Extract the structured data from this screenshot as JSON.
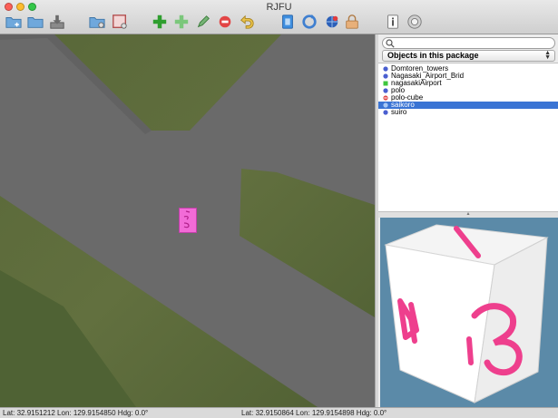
{
  "window": {
    "title": "RJFU"
  },
  "toolbar": {
    "buttons": [
      {
        "name": "new-project-button",
        "icon": "folder-plus-icon"
      },
      {
        "name": "open-folder-button",
        "icon": "folder-icon"
      },
      {
        "name": "save-button",
        "icon": "download-tray-icon"
      },
      {
        "name": "open-package-button",
        "icon": "folder-gear-icon"
      },
      {
        "name": "package-settings-button",
        "icon": "frame-gear-icon"
      },
      {
        "name": "add-object-button",
        "icon": "plus-green-icon"
      },
      {
        "name": "add-light-button",
        "icon": "plus-light-green-icon"
      },
      {
        "name": "edit-object-button",
        "icon": "pencil-icon"
      },
      {
        "name": "delete-object-button",
        "icon": "no-entry-icon"
      },
      {
        "name": "undo-button",
        "icon": "undo-arrow-icon"
      },
      {
        "name": "copy-button",
        "icon": "copy-doc-icon"
      },
      {
        "name": "refresh-button",
        "icon": "refresh-icon"
      },
      {
        "name": "globe-button",
        "icon": "globe-icon"
      },
      {
        "name": "lock-button",
        "icon": "lock-icon"
      },
      {
        "name": "info-button",
        "icon": "info-icon"
      },
      {
        "name": "settings-button",
        "icon": "gear-icon"
      }
    ]
  },
  "panel": {
    "search": {
      "placeholder": "",
      "value": ""
    },
    "dropdown": {
      "selected": "Objects in this package"
    },
    "objects": [
      {
        "label": "Domtoren_towers",
        "icon": "blue-diamond-icon",
        "selected": false
      },
      {
        "label": "Nagasaki_Airport_Brid",
        "icon": "blue-diamond-icon",
        "selected": false
      },
      {
        "label": "nagasakiAirport",
        "icon": "green-square-icon",
        "selected": false
      },
      {
        "label": "polo",
        "icon": "blue-diamond-icon",
        "selected": false
      },
      {
        "label": "polo-cube",
        "icon": "red-no-entry-icon",
        "selected": false
      },
      {
        "label": "saikoro",
        "icon": "light-blue-circle-icon",
        "selected": true
      },
      {
        "label": "suiro",
        "icon": "blue-diamond-icon",
        "selected": false
      }
    ]
  },
  "status": {
    "left": "Lat: 32.9151212  Lon: 129.9154850  Hdg: 0.0°",
    "right": "Lat: 32.9150864  Lon: 129.9154898  Hdg: 0.0°"
  },
  "colors": {
    "selection": "#3a74d4",
    "marker": "#f26bd7",
    "preview_bg": "#5b8aa8",
    "road": "#6a6a6a"
  }
}
